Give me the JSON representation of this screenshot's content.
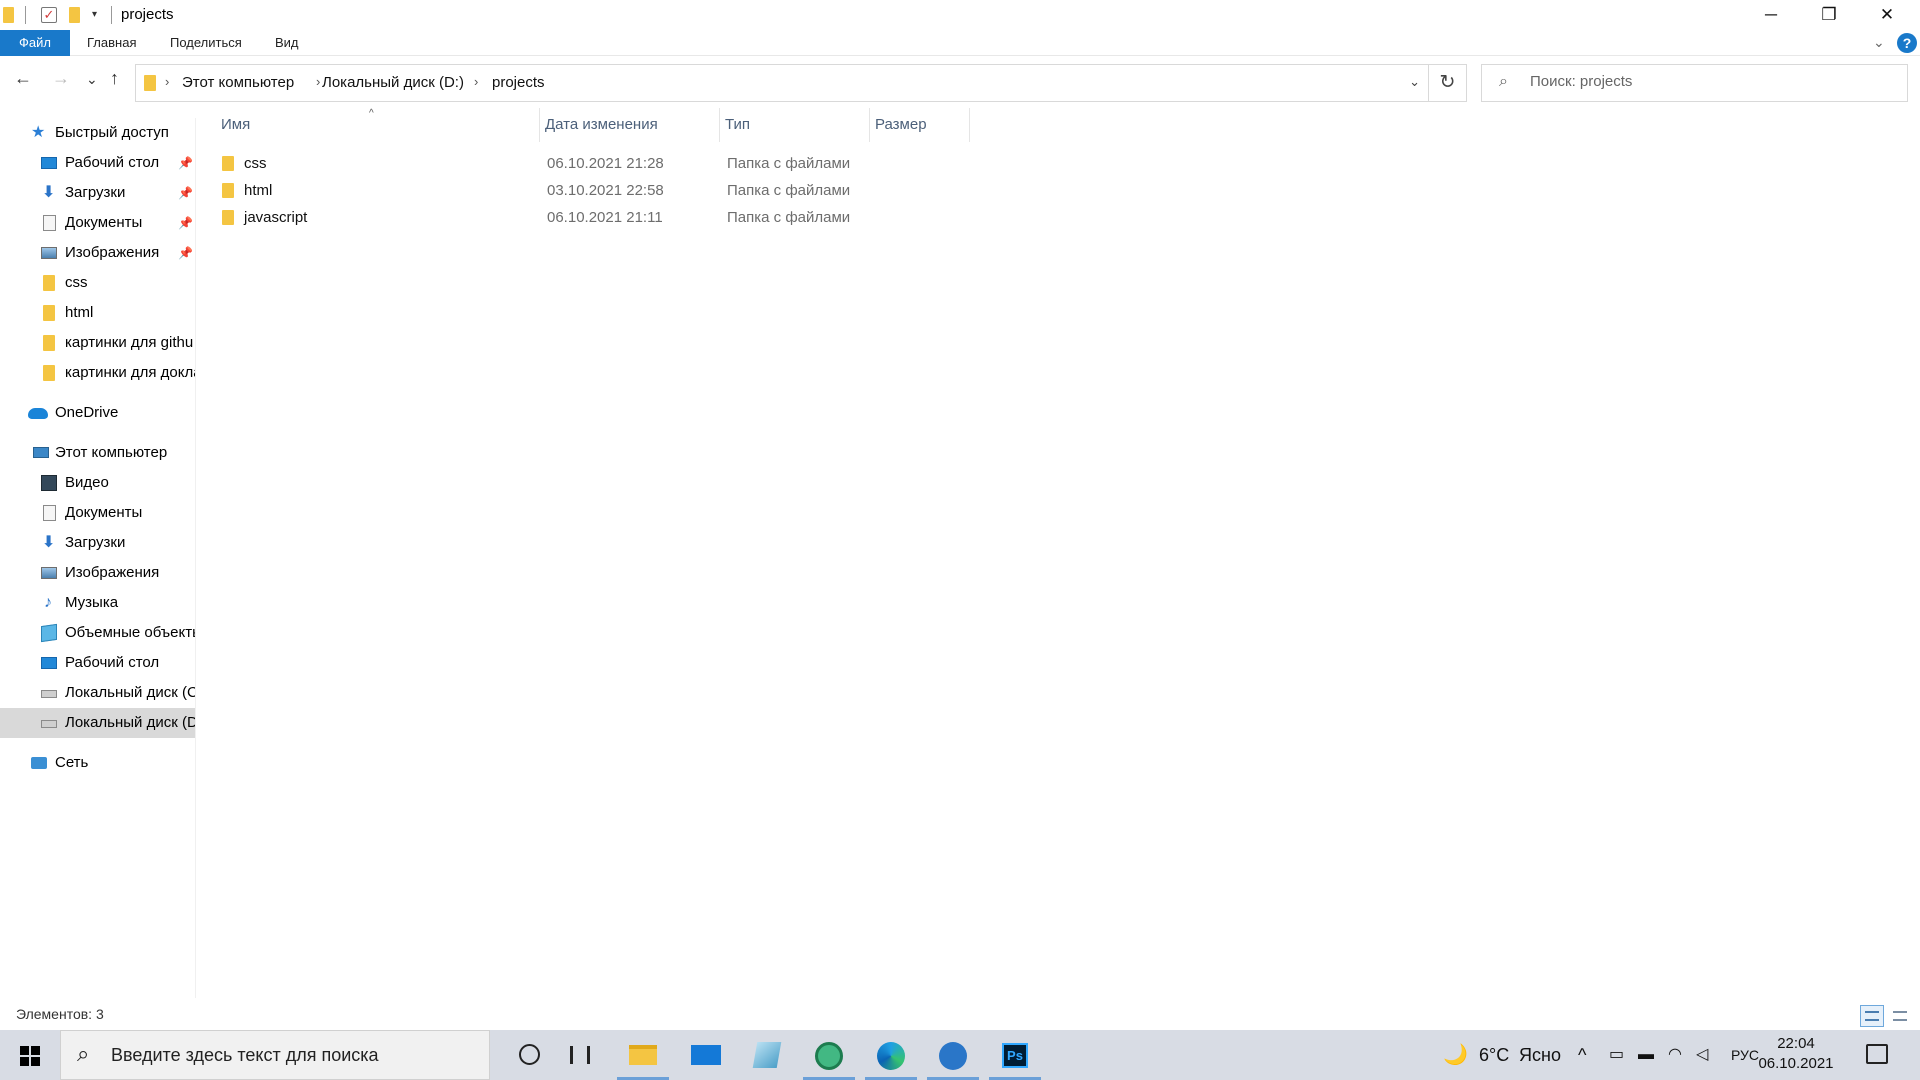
{
  "window": {
    "title": "projects",
    "minimize_glyph": "─",
    "maximize_glyph": "❐",
    "close_glyph": "✕",
    "quick_access_dropdown": "▾"
  },
  "ribbon": {
    "tabs": [
      "Файл",
      "Главная",
      "Поделиться",
      "Вид"
    ],
    "collapse_glyph": "⌄",
    "help_glyph": "?"
  },
  "nav_buttons": {
    "back": "←",
    "forward": "→",
    "recent": "⌄",
    "up": "↑"
  },
  "address": {
    "breadcrumbs": [
      "Этот компьютер",
      "Локальный диск (D:)",
      "projects"
    ],
    "separator": "›",
    "dropdown_glyph": "⌄",
    "refresh_glyph": "↻"
  },
  "search": {
    "placeholder": "Поиск: projects",
    "icon": "search-icon",
    "glyph": "⌕"
  },
  "navpane": {
    "quick_access": {
      "label": "Быстрый доступ",
      "icon": "star-icon",
      "glyph": "★"
    },
    "quick_items": [
      {
        "label": "Рабочий стол",
        "icon": "desktop-icon",
        "pinned": true
      },
      {
        "label": "Загрузки",
        "icon": "downloads-icon",
        "pinned": true
      },
      {
        "label": "Документы",
        "icon": "documents-icon",
        "pinned": true
      },
      {
        "label": "Изображения",
        "icon": "pictures-icon",
        "pinned": true
      },
      {
        "label": "css",
        "icon": "folder-icon",
        "pinned": false
      },
      {
        "label": "html",
        "icon": "folder-icon",
        "pinned": false
      },
      {
        "label": "картинки для githu",
        "icon": "folder-icon",
        "pinned": false
      },
      {
        "label": "картинки для докла",
        "icon": "folder-icon",
        "pinned": false
      }
    ],
    "pin_glyph": "📌",
    "onedrive": "OneDrive",
    "this_pc": "Этот компьютер",
    "pc_items": [
      {
        "label": "Видео",
        "icon": "video-icon"
      },
      {
        "label": "Документы",
        "icon": "documents-icon"
      },
      {
        "label": "Загрузки",
        "icon": "downloads-icon"
      },
      {
        "label": "Изображения",
        "icon": "pictures-icon"
      },
      {
        "label": "Музыка",
        "icon": "music-icon"
      },
      {
        "label": "Объемные объекты",
        "icon": "3d-objects-icon"
      },
      {
        "label": "Рабочий стол",
        "icon": "desktop-icon"
      },
      {
        "label": "Локальный диск (C:)",
        "icon": "drive-icon"
      },
      {
        "label": "Локальный диск (D:)",
        "icon": "drive-icon",
        "selected": true
      }
    ],
    "network": "Сеть"
  },
  "file_list": {
    "columns": [
      "Имя",
      "Дата изменения",
      "Тип",
      "Размер"
    ],
    "sort_glyph": "^",
    "rows": [
      {
        "name": "css",
        "modified": "06.10.2021 21:28",
        "type": "Папка с файлами",
        "size": ""
      },
      {
        "name": "html",
        "modified": "03.10.2021 22:58",
        "type": "Папка с файлами",
        "size": ""
      },
      {
        "name": "javascript",
        "modified": "06.10.2021 21:11",
        "type": "Папка с файлами",
        "size": ""
      }
    ]
  },
  "status": {
    "items_text": "Элементов: 3",
    "active_view": "details"
  },
  "taskbar": {
    "search_placeholder": "Введите здесь текст для поиска",
    "apps": [
      "file-explorer-icon",
      "mail-icon",
      "notes-icon",
      "atom-icon",
      "edge-icon",
      "thunderbird-icon",
      "photoshop-icon"
    ],
    "photoshop_label": "Ps",
    "weather": {
      "glyph": "🌙",
      "temp": "6°C",
      "condition": "Ясно"
    },
    "tray_chevron": "^",
    "language": "РУС",
    "time": "22:04",
    "date": "06.10.2021"
  }
}
